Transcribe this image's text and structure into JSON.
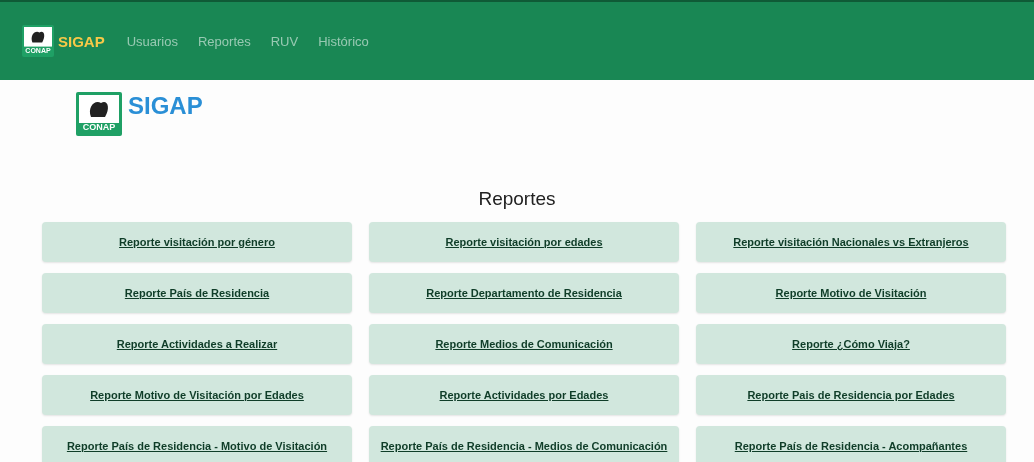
{
  "navbar": {
    "logo": {
      "mark": "CONAP",
      "name": "SIGAP"
    },
    "links": [
      {
        "label": "Usuarios"
      },
      {
        "label": "Reportes"
      },
      {
        "label": "RUV"
      },
      {
        "label": "Histórico"
      }
    ]
  },
  "hero_logo": {
    "mark": "CONAP",
    "name": "SIGAP"
  },
  "heading": "Reportes",
  "reports": [
    {
      "label": "Reporte visitación por género"
    },
    {
      "label": "Reporte visitación por edades"
    },
    {
      "label": "Reporte visitación Nacionales vs Extranjeros"
    },
    {
      "label": "Reporte País de Residencia"
    },
    {
      "label": "Reporte Departamento de Residencia"
    },
    {
      "label": "Reporte Motivo de Visitación"
    },
    {
      "label": "Reporte Actividades a Realizar"
    },
    {
      "label": "Reporte Medios de Comunicación"
    },
    {
      "label": "Reporte ¿Cómo Viaja?"
    },
    {
      "label": "Reporte Motivo de Visitación por Edades"
    },
    {
      "label": "Reporte Actividades por Edades"
    },
    {
      "label": "Reporte Pais de Residencia por Edades"
    },
    {
      "label": "Reporte País de Residencia - Motivo de Visitación"
    },
    {
      "label": "Reporte País de Residencia - Medios de Comunicación"
    },
    {
      "label": "Reporte País de Residencia - Acompañantes"
    }
  ]
}
